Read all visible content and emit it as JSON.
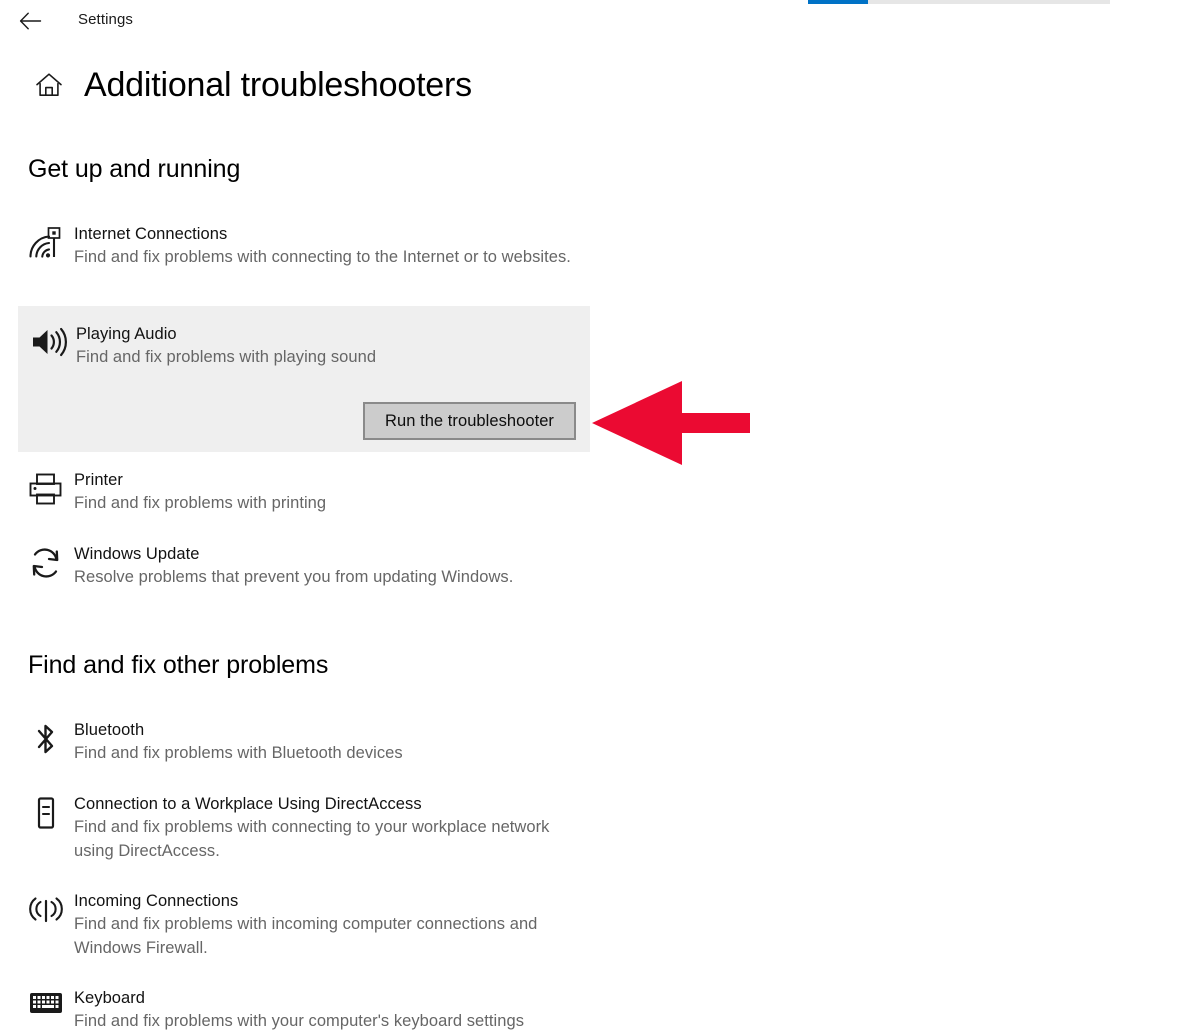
{
  "window": {
    "app_name": "Settings",
    "back_icon": "back-arrow-icon",
    "home_icon": "home-icon",
    "page_title": "Additional troubleshooters"
  },
  "progress": {
    "icon": "progress-bar",
    "percent": 20,
    "fill_color": "#0072c6",
    "track_color": "#e6e6e6"
  },
  "sections": [
    {
      "heading": "Get up and running",
      "items": [
        {
          "icon": "internet-connections-icon",
          "name": "Internet Connections",
          "description": "Find and fix problems with connecting to the Internet or to websites.",
          "selected": false
        },
        {
          "icon": "playing-audio-icon",
          "name": "Playing Audio",
          "description": "Find and fix problems with playing sound",
          "selected": true,
          "action_label": "Run the troubleshooter"
        },
        {
          "icon": "printer-icon",
          "name": "Printer",
          "description": "Find and fix problems with printing",
          "selected": false
        },
        {
          "icon": "windows-update-icon",
          "name": "Windows Update",
          "description": "Resolve problems that prevent you from updating Windows.",
          "selected": false
        }
      ]
    },
    {
      "heading": "Find and fix other problems",
      "items": [
        {
          "icon": "bluetooth-icon",
          "name": "Bluetooth",
          "description": "Find and fix problems with Bluetooth devices",
          "selected": false
        },
        {
          "icon": "directaccess-icon",
          "name": "Connection to a Workplace Using DirectAccess",
          "description": "Find and fix problems with connecting to your workplace network using DirectAccess.",
          "selected": false
        },
        {
          "icon": "incoming-connections-icon",
          "name": "Incoming Connections",
          "description": "Find and fix problems with incoming computer connections and Windows Firewall.",
          "selected": false
        },
        {
          "icon": "keyboard-icon",
          "name": "Keyboard",
          "description": "Find and fix problems with your computer's keyboard settings",
          "selected": false
        }
      ]
    }
  ],
  "annotation": {
    "icon": "left-pointing-arrow-annotation",
    "color": "#eb0a32"
  }
}
